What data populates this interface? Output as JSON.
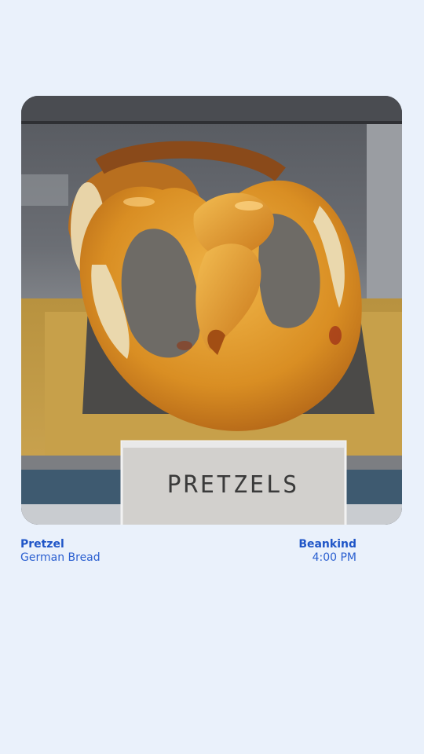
{
  "photo": {
    "sign_text": "PRETZELS"
  },
  "caption": {
    "left": {
      "title": "Pretzel",
      "subtitle": "German Bread"
    },
    "right": {
      "title": "Beankind",
      "subtitle": "4:00 PM"
    }
  },
  "colors": {
    "background": "#eaf1fb",
    "accent": "#1f55c7"
  }
}
